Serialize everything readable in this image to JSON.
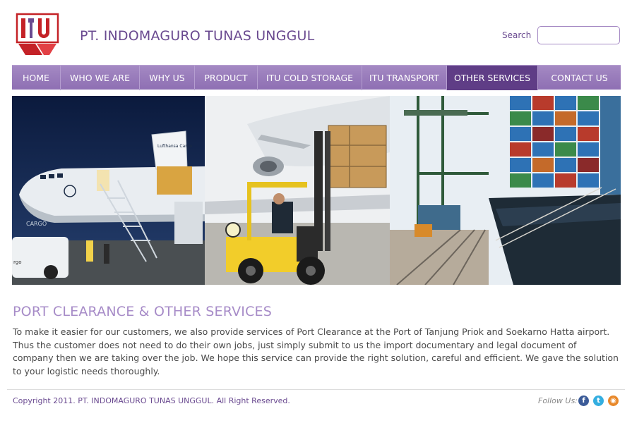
{
  "header": {
    "company_name": "PT. INDOMAGURO TUNAS UNGGUL",
    "search_label": "Search",
    "search_value": "",
    "search_placeholder": ""
  },
  "nav": {
    "items": [
      {
        "label": "HOME"
      },
      {
        "label": "WHO WE ARE"
      },
      {
        "label": "WHY US"
      },
      {
        "label": "PRODUCT"
      },
      {
        "label": "ITU COLD STORAGE"
      },
      {
        "label": "ITU TRANSPORT"
      },
      {
        "label": "OTHER SERVICES"
      },
      {
        "label": "CONTACT US"
      }
    ],
    "active_index": 6
  },
  "banner": {
    "plane_text": "Lufthansa Cargo",
    "cargo_text": "CARGO"
  },
  "content": {
    "title": "PORT CLEARANCE & OTHER SERVICES",
    "body": "To make it easier for our customers, we also provide services of Port Clearance at the Port of Tanjung Priok and Soekarno Hatta airport. Thus the customer does not need to do their own jobs, just simply submit to us the import documentary and legal document of company then we are taking over the job. We hope this service can provide the right solution, careful and efficient. We gave the solution to your logistic needs thoroughly."
  },
  "footer": {
    "copyright": "Copyright 2011. PT. INDOMAGURO TUNAS UNGGUL. All Right Reserved.",
    "follow_label": "Follow Us:",
    "facebook_glyph": "f",
    "twitter_glyph": "t",
    "rss_glyph": "◉"
  },
  "colors": {
    "brand_purple": "#6a4a90",
    "nav_active": "#5f3d86",
    "nav_bg": "#9b7fbd",
    "title_lilac": "#a78cc8"
  }
}
